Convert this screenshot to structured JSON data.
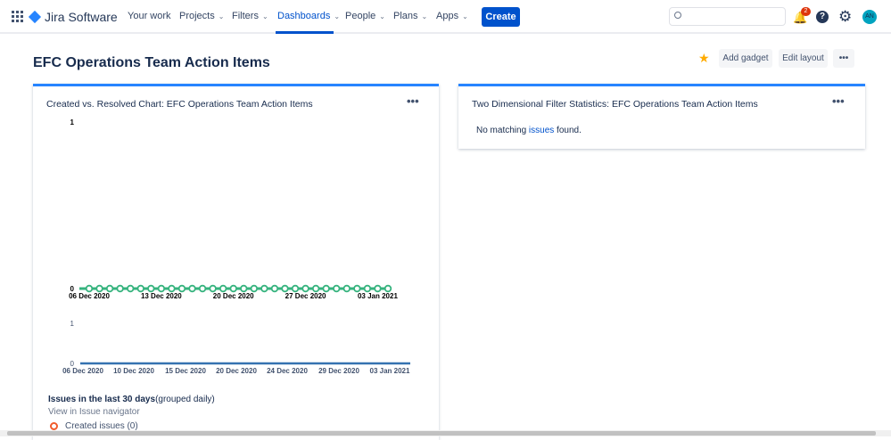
{
  "nav": {
    "brand": "Jira Software",
    "items": [
      {
        "label": "Your work",
        "chev": false
      },
      {
        "label": "Projects",
        "chev": true
      },
      {
        "label": "Filters",
        "chev": true
      },
      {
        "label": "Dashboards",
        "chev": true,
        "active": true
      },
      {
        "label": "People",
        "chev": true
      },
      {
        "label": "Plans",
        "chev": true
      },
      {
        "label": "Apps",
        "chev": true
      }
    ],
    "create": "Create",
    "search_placeholder": "",
    "notification_count": "2",
    "avatar": "AN"
  },
  "page": {
    "title": "EFC Operations Team Action Items",
    "add_gadget": "Add gadget",
    "edit_layout": "Edit layout",
    "more": "•••"
  },
  "gadget1": {
    "title": "Created vs. Resolved Chart: EFC Operations Team Action Items",
    "more": "•••",
    "summary_bold": "Issues in the last 30 days",
    "summary_rest": "(grouped daily)",
    "link": "View in Issue navigator",
    "legend_created": "Created issues (0)"
  },
  "gadget2": {
    "title": "Two Dimensional Filter Statistics: EFC Operations Team Action Items",
    "more": "•••",
    "msg_pre": "No matching ",
    "msg_link": "issues",
    "msg_post": " found."
  },
  "chart_data": [
    {
      "type": "line",
      "ylim": [
        0,
        1
      ],
      "yticks": [
        "0",
        "1"
      ],
      "xticks": [
        "06 Dec 2020",
        "13 Dec 2020",
        "20 Dec 2020",
        "27 Dec 2020",
        "03 Jan 2021"
      ],
      "x_start": "06 Dec 2020",
      "x_end": "04 Jan 2021",
      "series": [
        {
          "values": [
            0,
            0,
            0,
            0,
            0,
            0,
            0,
            0,
            0,
            0,
            0,
            0,
            0,
            0,
            0,
            0,
            0,
            0,
            0,
            0,
            0,
            0,
            0,
            0,
            0,
            0,
            0,
            0,
            0,
            0
          ],
          "color": "#36b37e"
        }
      ]
    },
    {
      "type": "line",
      "ylim": [
        0,
        1
      ],
      "yticks": [
        "0",
        "1"
      ],
      "xticks": [
        "06 Dec 2020",
        "10 Dec 2020",
        "15 Dec 2020",
        "20 Dec 2020",
        "24 Dec 2020",
        "29 Dec 2020",
        "03 Jan 2021"
      ],
      "series": [
        {
          "values": [
            0,
            0
          ],
          "color": "#3572b0"
        }
      ]
    }
  ]
}
